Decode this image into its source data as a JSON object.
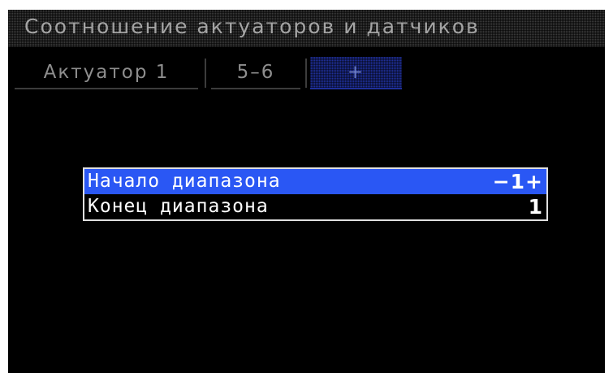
{
  "window": {
    "title": "Соотношение актуаторов и датчиков"
  },
  "tabs": [
    {
      "label": "Актуатор 1",
      "active": false
    },
    {
      "label": "5–6",
      "active": false
    },
    {
      "label": "+",
      "active": true
    }
  ],
  "range_list": {
    "rows": [
      {
        "label": "Начало диапазона",
        "value": "−1+",
        "selected": true
      },
      {
        "label": "Конец диапазона",
        "value": "1",
        "selected": false
      }
    ]
  },
  "colors": {
    "background": "#000000",
    "selection": "#2a57f4",
    "active_tab": "#1f2f99",
    "inactive_text": "#8e8e8e"
  }
}
